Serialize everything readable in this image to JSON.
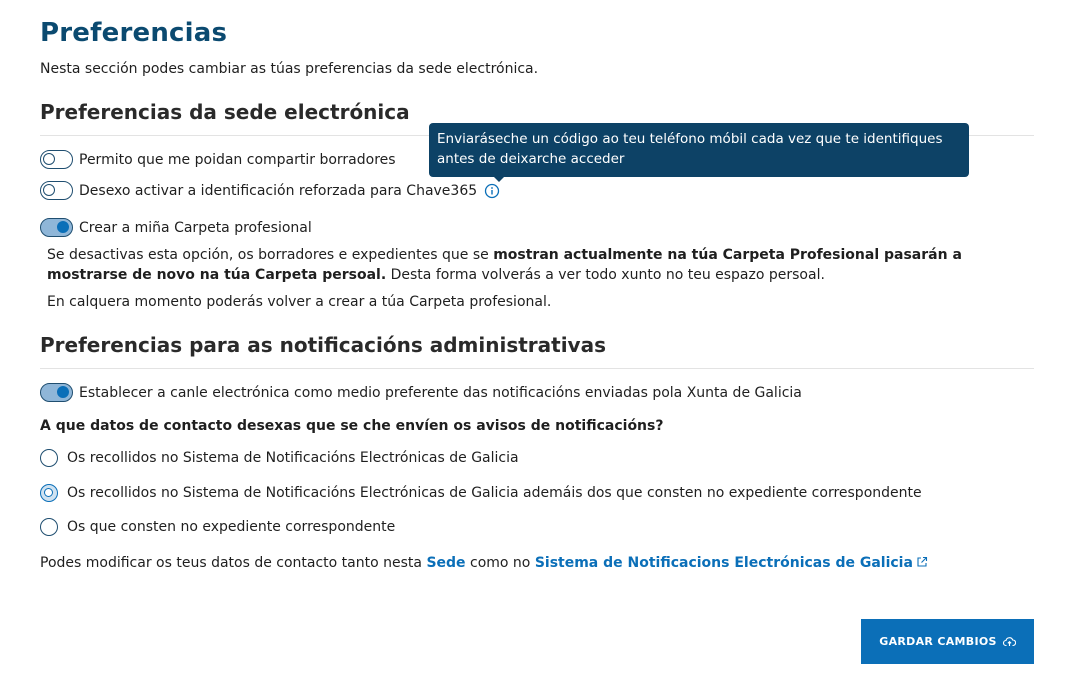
{
  "header": {
    "title": "Preferencias",
    "intro": "Nesta sección podes cambiar as túas preferencias da sede electrónica."
  },
  "sede_section": {
    "heading": "Preferencias da sede electrónica",
    "toggles": [
      {
        "label": "Permito que me poidan compartir borradores",
        "on": false
      },
      {
        "label": "Desexo activar a identificación reforzada para Chave365",
        "on": false,
        "icon": "info-icon"
      },
      {
        "label": "Crear a miña Carpeta profesional",
        "on": true
      }
    ],
    "tooltip": "Enviaráseche un código ao teu teléfono móbil cada vez que te identifiques antes de deixarche acceder",
    "note_part1": "Se desactivas esta opción, os borradores e expedientes que se ",
    "note_bold": "mostran actualmente na túa Carpeta Profesional pasarán a mostrarse de novo na túa Carpeta persoal.",
    "note_part2": " Desta forma volverás a ver todo xunto no teu espazo persoal.",
    "note2": "En calquera momento poderás volver a crear a túa Carpeta profesional."
  },
  "notif_section": {
    "heading": "Preferencias para as notificacións administrativas",
    "toggle_label": "Establecer a canle electrónica como medio preferente das notificacións enviadas pola Xunta de Galicia",
    "toggle_on": true,
    "question": "A que datos de contacto desexas que se che envíen os avisos de notificacións?",
    "options": [
      {
        "label": "Os recollidos no Sistema de Notificacións Electrónicas de Galicia",
        "checked": false
      },
      {
        "label": "Os recollidos no Sistema de Notificacións Electrónicas de Galicia ademáis dos que consten no expediente correspondente",
        "checked": true
      },
      {
        "label": "Os que consten no expediente correspondente",
        "checked": false
      }
    ]
  },
  "footer": {
    "text1": "Podes modificar os teus datos de contacto tanto nesta ",
    "link1": "Sede",
    "text2": " como no ",
    "link2": "Sistema de Notificacions Electrónicas de Galicia",
    "link2_icon": "external-link-icon"
  },
  "actions": {
    "save_label": "GARDAR CAMBIOS",
    "save_icon": "cloud-upload-icon"
  },
  "colors": {
    "title": "#0b4a70",
    "accent": "#0b6fb8",
    "tooltip_bg": "#0d4266"
  }
}
